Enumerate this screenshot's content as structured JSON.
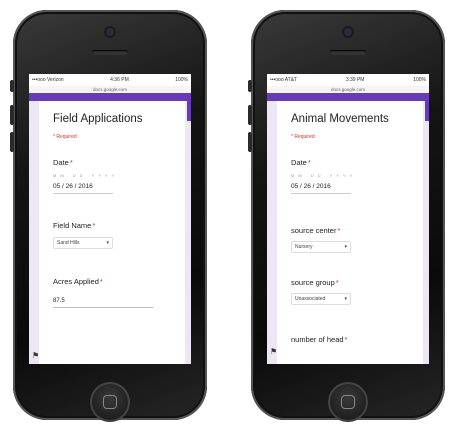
{
  "phones": [
    {
      "status": {
        "carrier": "•••ooo Verizon",
        "time": "4:36 PM",
        "battery": "100%"
      },
      "url": "docs.google.com",
      "form": {
        "title": "Field Applications",
        "required_note": "* Required",
        "questions": [
          {
            "label": "Date",
            "subfields": "MM  DD  YYYY",
            "value": "05 / 26 / 2016"
          },
          {
            "label": "Field Name",
            "value": "Sand Hills"
          },
          {
            "label": "Acres Applied",
            "value": "87.5"
          }
        ]
      }
    },
    {
      "status": {
        "carrier": "•••ooo AT&T",
        "time": "3:39 PM",
        "battery": "100%"
      },
      "url": "docs.google.com",
      "form": {
        "title": "Animal Movements",
        "required_note": "* Required",
        "questions": [
          {
            "label": "Date",
            "subfields": "MM  DD  YYYY",
            "value": "05 / 26 / 2016"
          },
          {
            "label": "source center",
            "value": "Nursery"
          },
          {
            "label": "source group",
            "value": "Unassociated"
          },
          {
            "label": "number of head",
            "value": ""
          }
        ]
      }
    }
  ],
  "icons": {
    "dropdown": "chevron-down-icon",
    "report": "flag-icon"
  },
  "colors": {
    "accent": "#673ab7",
    "required": "#d93025",
    "form_bg": "#ece6f5"
  }
}
